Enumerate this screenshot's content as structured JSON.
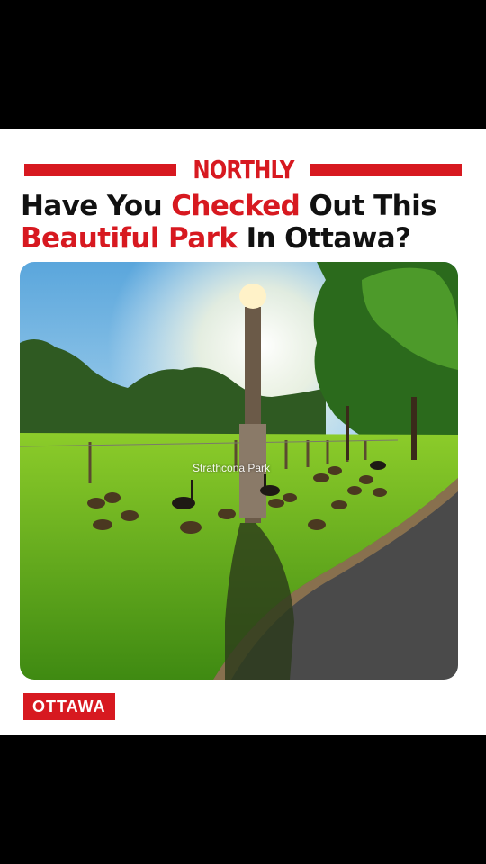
{
  "brand": {
    "name": "NORTHLY",
    "color": "#d71920"
  },
  "headline": {
    "part1": "Have You ",
    "accent1": "Checked",
    "part2": " Out This",
    "accent2": "Beautiful Park",
    "part3": " In Ottawa?"
  },
  "photo": {
    "caption": "Strathcona Park",
    "description_icon": "park-photo"
  },
  "tag": {
    "label": "OTTAWA"
  }
}
